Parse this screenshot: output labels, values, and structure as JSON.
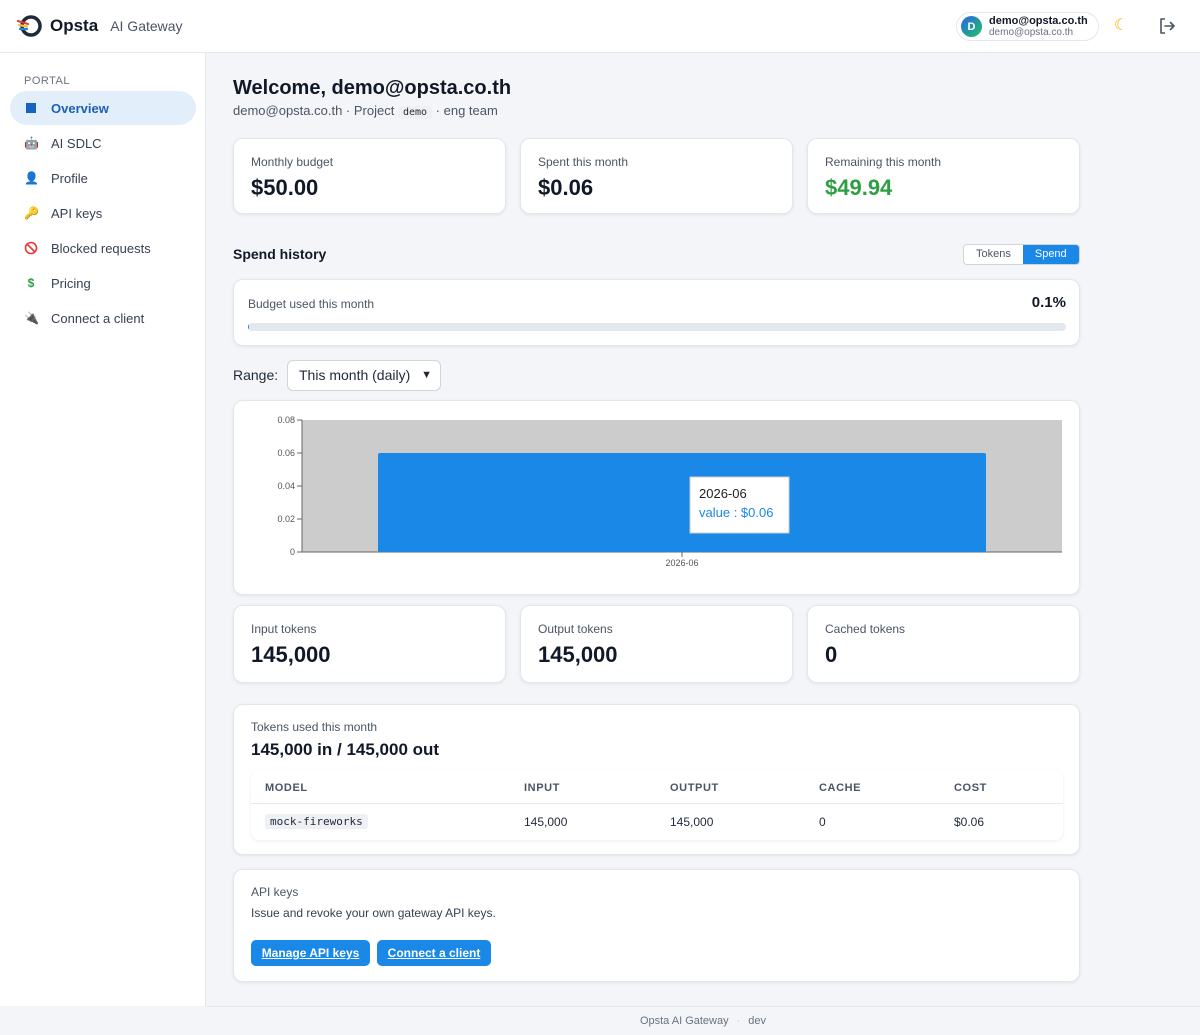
{
  "header": {
    "brand_name": "Opsta",
    "brand_sub": "AI Gateway",
    "user_initial": "D",
    "user_name": "demo@opsta.co.th",
    "user_email": "demo@opsta.co.th",
    "theme_icon": "moon-icon",
    "logout_icon": "logout-icon"
  },
  "sidebar": {
    "section": "PORTAL",
    "items": [
      {
        "label": "Overview",
        "icon": "grid-icon",
        "active": true
      },
      {
        "label": "AI SDLC",
        "icon": "robot-icon"
      },
      {
        "label": "Profile",
        "icon": "user-icon"
      },
      {
        "label": "API keys",
        "icon": "key-icon"
      },
      {
        "label": "Blocked requests",
        "icon": "blocked-icon"
      },
      {
        "label": "Pricing",
        "icon": "dollar-icon"
      },
      {
        "label": "Connect a client",
        "icon": "plug-icon"
      }
    ]
  },
  "main": {
    "welcome": "Welcome, demo@opsta.co.th",
    "sub_prefix": "demo@opsta.co.th · Project",
    "project": "demo",
    "sub_suffix": "· eng team",
    "stats": [
      {
        "label": "Monthly budget",
        "value": "$50.00"
      },
      {
        "label": "Spent this month",
        "value": "$0.06"
      },
      {
        "label": "Remaining this month",
        "value": "$49.94"
      }
    ],
    "spend_history_title": "Spend history",
    "toggle": {
      "tokens": "Tokens",
      "spend": "Spend",
      "active": "Spend"
    },
    "budget_used_label": "Budget used this month",
    "budget_used_pct": "0.1%",
    "budget_used_fraction": 0.001,
    "range_label": "Range:",
    "range_value": "This month (daily)",
    "token_stats": [
      {
        "label": "Input tokens",
        "value": "145,000"
      },
      {
        "label": "Output tokens",
        "value": "145,000"
      },
      {
        "label": "Cached tokens",
        "value": "0"
      }
    ],
    "tokens_used_title": "Tokens used this month",
    "tokens_used_summary": "145,000 in / 145,000 out",
    "table": {
      "headers": [
        "MODEL",
        "INPUT",
        "OUTPUT",
        "CACHE",
        "COST"
      ],
      "rows": [
        {
          "model": "mock-fireworks",
          "input": "145,000",
          "output": "145,000",
          "cache": "0",
          "cost": "$0.06"
        }
      ]
    },
    "api": {
      "title": "API keys",
      "desc": "Issue and revoke your own gateway API keys.",
      "manage_btn": "Manage API keys",
      "connect_btn": "Connect a client"
    }
  },
  "chart_data": {
    "type": "bar",
    "categories": [
      "2026-06"
    ],
    "values": [
      0.06
    ],
    "ylim": [
      0,
      0.08
    ],
    "yticks": [
      "0",
      "0.02",
      "0.04",
      "0.06",
      "0.08"
    ],
    "tooltip": {
      "title": "2026-06",
      "value_label": "value : $0.06"
    },
    "bar_color": "#1a88e6",
    "plot_background": "#cccccc"
  },
  "footer": {
    "left": "Opsta AI Gateway",
    "sep": "·",
    "right": "dev"
  }
}
